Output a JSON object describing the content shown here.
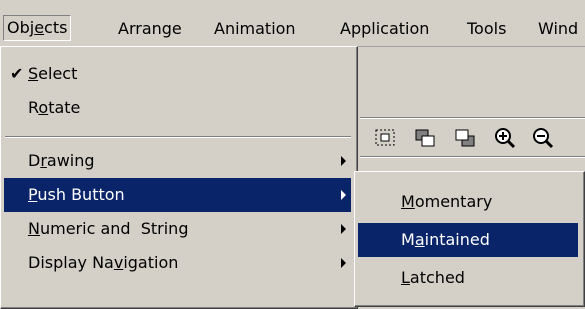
{
  "menubar": {
    "items": [
      {
        "label": "Objects"
      },
      {
        "label": "Arrange"
      },
      {
        "label": "Animation"
      },
      {
        "label": "Application"
      },
      {
        "label": "Tools"
      },
      {
        "label": "Wind"
      }
    ]
  },
  "objects_menu": {
    "items": [
      {
        "label": "Select",
        "checked": true
      },
      {
        "label": "Rotate"
      },
      {
        "label": "Drawing",
        "submenu": true
      },
      {
        "label": "Push Button",
        "submenu": true,
        "highlighted": true
      },
      {
        "label": "Numeric and  String",
        "submenu": true
      },
      {
        "label": "Display Navigation",
        "submenu": true
      }
    ]
  },
  "push_button_submenu": {
    "items": [
      {
        "label": "Momentary"
      },
      {
        "label": "Maintained",
        "highlighted": true
      },
      {
        "label": "Latched"
      }
    ]
  },
  "toolbar": {
    "icons": [
      "select-region-icon",
      "bring-forward-icon",
      "send-backward-icon",
      "zoom-in-icon",
      "zoom-out-icon"
    ]
  },
  "colors": {
    "highlight": "#0a246a",
    "face": "#d4d0c8"
  }
}
